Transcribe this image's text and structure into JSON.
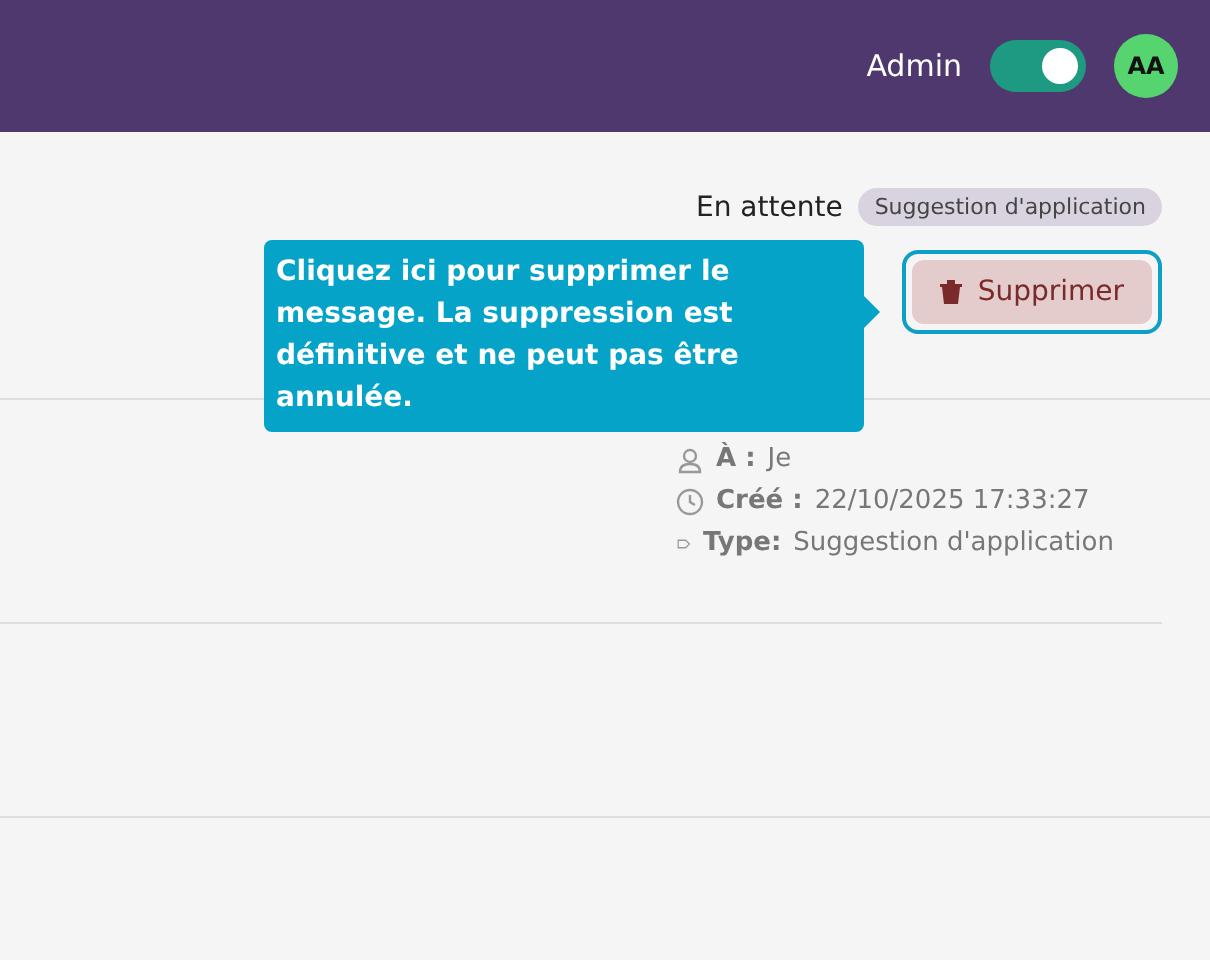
{
  "header": {
    "role_label": "Admin",
    "admin_toggle": {
      "on": true
    },
    "avatar": "AA"
  },
  "message": {
    "status": "En attente",
    "type_badge": "Suggestion d'application",
    "delete_button": "Supprimer",
    "meta": [
      {
        "kind": "person",
        "label": "À :",
        "value": "Je"
      },
      {
        "kind": "clock",
        "label": "Créé :",
        "value": "22/10/2025 17:33:27"
      },
      {
        "kind": "tag",
        "label": "Type:",
        "value": "Suggestion d'application"
      }
    ]
  },
  "tooltip": {
    "text": "Cliquez ici pour supprimer le message. La suppression est définitive et ne peut pas être annulée."
  }
}
